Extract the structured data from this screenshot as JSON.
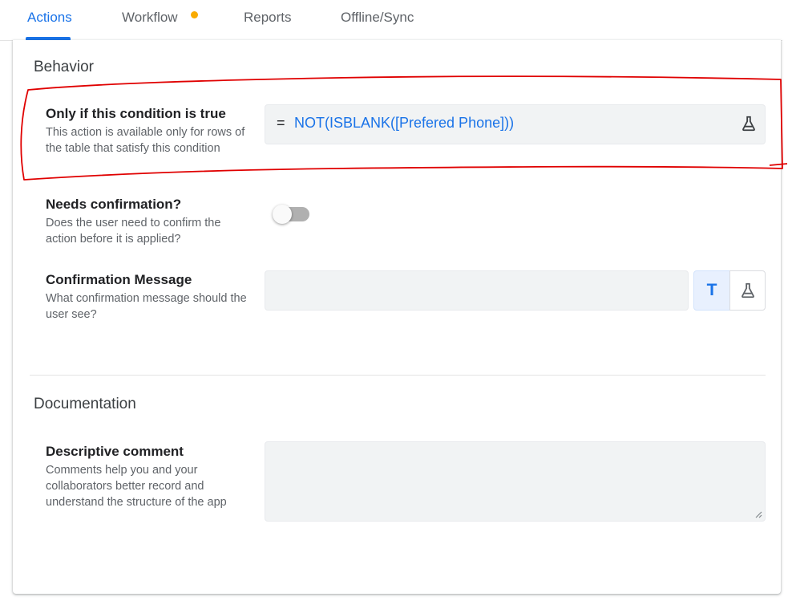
{
  "tabs": [
    {
      "label": "Actions",
      "active": true
    },
    {
      "label": "Workflow",
      "has_notification": true
    },
    {
      "label": "Reports"
    },
    {
      "label": "Offline/Sync"
    }
  ],
  "behavior": {
    "title": "Behavior",
    "condition": {
      "label": "Only if this condition is true",
      "description": "This action is available only for rows of the table that satisfy this condition",
      "equals_sign": "=",
      "formula": "NOT(ISBLANK([Prefered Phone]))"
    },
    "confirmation": {
      "label": "Needs confirmation?",
      "description": "Does the user need to confirm the action before it is applied?",
      "enabled": false
    },
    "confirmation_message": {
      "label": "Confirmation Message",
      "description": "What confirmation message should the user see?",
      "value": "",
      "text_button_label": "T"
    }
  },
  "documentation": {
    "title": "Documentation",
    "comment": {
      "label": "Descriptive comment",
      "description": "Comments help you and your collaborators better record and understand the structure of the app",
      "value": ""
    }
  },
  "colors": {
    "accent": "#1a73e8",
    "notification_dot": "#f9ab00",
    "annotation": "#e00000"
  },
  "icons": {
    "expression_tester": "flask-icon"
  }
}
